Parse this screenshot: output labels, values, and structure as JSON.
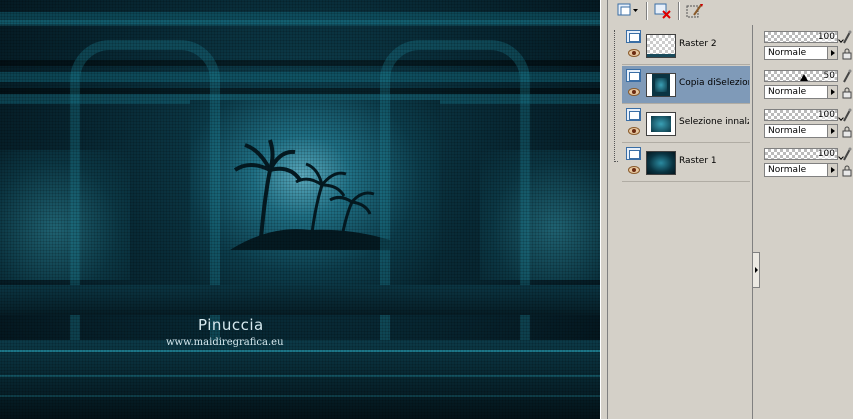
{
  "canvas": {
    "watermark_name": "Pinuccia",
    "watermark_url": "www.maidiregrafica.eu"
  },
  "toolbar": {
    "buttons": [
      {
        "icon": "new-layer-icon"
      },
      {
        "icon": "delete-layer-icon"
      },
      {
        "icon": "mask-edit-icon"
      }
    ]
  },
  "layers": [
    {
      "name": "Raster 2",
      "thumb": "checker",
      "selected": false
    },
    {
      "name": "Copia diSelezione",
      "thumb": "mid",
      "selected": true
    },
    {
      "name": "Selezione innalza",
      "thumb": "sel2",
      "selected": false
    },
    {
      "name": "Raster 1",
      "thumb": "dark",
      "selected": false
    }
  ],
  "properties": [
    {
      "opacity": 100,
      "opacity_label": "100",
      "blend_mode": "Normale"
    },
    {
      "opacity": 50,
      "opacity_label": "50",
      "blend_mode": "Normale"
    },
    {
      "opacity": 100,
      "opacity_label": "100",
      "blend_mode": "Normale"
    },
    {
      "opacity": 100,
      "opacity_label": "100",
      "blend_mode": "Normale"
    }
  ],
  "colors": {
    "selection": "#7f9ab8",
    "panel_bg": "#d4d0c8",
    "canvas_teal": "#0f4656"
  }
}
